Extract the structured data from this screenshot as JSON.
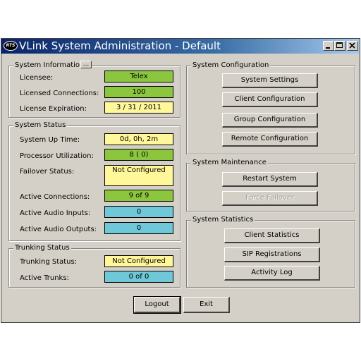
{
  "window": {
    "title": "VLink System Administration - Default",
    "icon_text": "RTS"
  },
  "colors": {
    "green": "#8cc63f",
    "yellow": "#fff799",
    "blue": "#6ec8d8"
  },
  "system_information": {
    "legend": "System Information",
    "more_button": "...",
    "licensee_label": "Licensee:",
    "licensee_value": "Telex",
    "licensed_connections_label": "Licensed Connections:",
    "licensed_connections_value": "100",
    "license_expiration_label": "License Expiration:",
    "license_expiration_value": "3 / 31 / 2011"
  },
  "system_status": {
    "legend": "System Status",
    "uptime_label": "System Up Time:",
    "uptime_value": "0d,  0h,  2m",
    "processor_label": "Processor Utilization:",
    "processor_value": "8 ( 0)",
    "failover_label": "Failover Status:",
    "failover_value": "Not Configured",
    "active_connections_label": "Active Connections:",
    "active_connections_value": "9 of 9",
    "audio_inputs_label": "Active Audio Inputs:",
    "audio_inputs_value": "0",
    "audio_outputs_label": "Active Audio Outputs:",
    "audio_outputs_value": "0"
  },
  "trunking_status": {
    "legend": "Trunking Status",
    "status_label": "Trunking Status:",
    "status_value": "Not Configured",
    "active_trunks_label": "Active Trunks:",
    "active_trunks_value": "0 of 0"
  },
  "system_configuration": {
    "legend": "System Configuration",
    "system_settings": "System Settings",
    "client_configuration": "Client Configuration",
    "group_configuration": "Group Configuration",
    "remote_configuration": "Remote Configuration"
  },
  "system_maintenance": {
    "legend": "System Maintenance",
    "restart_system": "Restart System",
    "force_failover": "Force Failover"
  },
  "system_statistics": {
    "legend": "System Statistics",
    "client_statistics": "Client Statistics",
    "sip_registrations": "SIP Registrations",
    "activity_log": "Activity Log"
  },
  "footer": {
    "logout": "Logout",
    "exit": "Exit"
  }
}
